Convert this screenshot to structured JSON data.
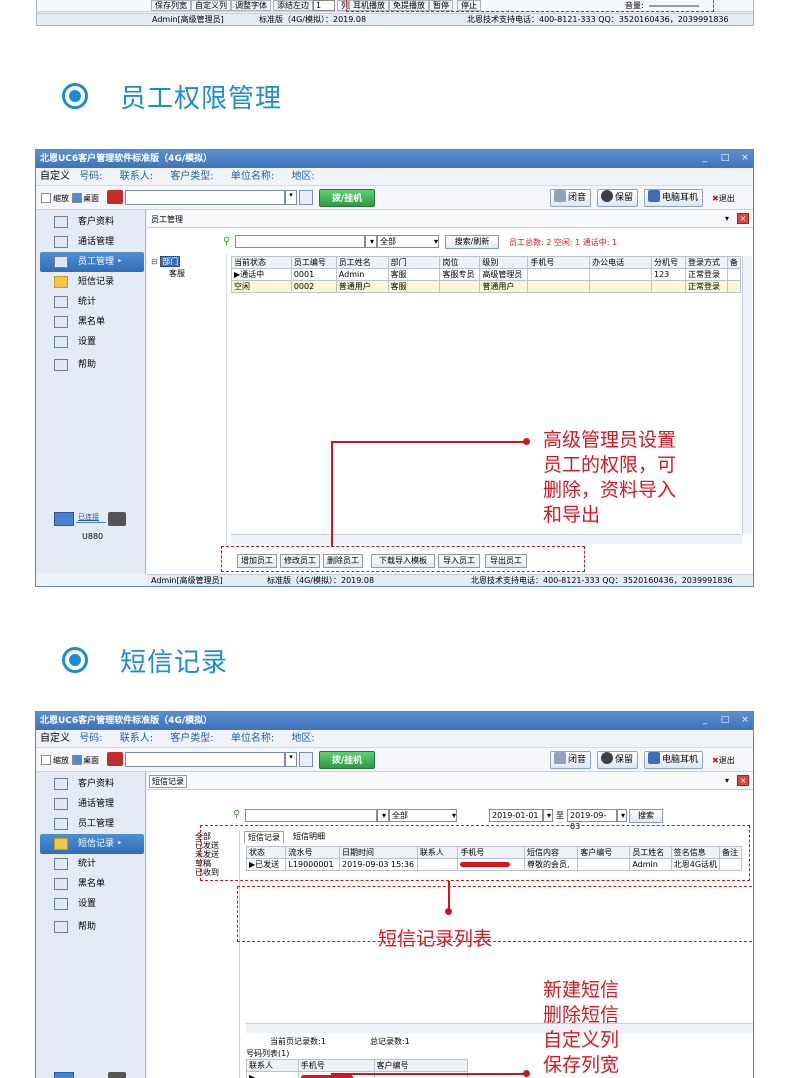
{
  "top_fragment": {
    "toolbar_items": [
      "保存列宽",
      "自定义列",
      "调整字体",
      "添结左边",
      "1",
      "列",
      "耳机播放",
      "免提播放",
      "暂停",
      "停止"
    ],
    "volume_label": "音量:",
    "status": {
      "user": "Admin[高级管理员]",
      "edition": "标准版（4G/模拟）：2019.08",
      "support": "北恩技术支持电话：400-8121-333  QQ：3520160436，2039991836"
    }
  },
  "section1": {
    "title": "员工权限管理"
  },
  "section2": {
    "title": "短信记录"
  },
  "app": {
    "title": "北恩UC6客户管理软件标准版（4G/模拟）",
    "window_controls": [
      "_",
      "□",
      "×"
    ],
    "menu": {
      "first": "自定义",
      "items": [
        "号码:",
        "联系人:",
        "客户类型:",
        "单位名称:",
        "地区:"
      ]
    },
    "toolbar": {
      "zoom": "缩放",
      "desktop": "桌面",
      "dial": "拨/挂机",
      "mute": "闭音",
      "hold": "保留",
      "pc_headset": "电脑耳机",
      "exit": "退出"
    },
    "sidebar": [
      "客户资料",
      "通话管理",
      "员工管理",
      "短信记录",
      "统计",
      "黑名单",
      "设置",
      "帮助"
    ],
    "connection": {
      "status": "已连接",
      "device": "U880"
    },
    "status": {
      "user": "Admin[高级管理员]",
      "edition": "标准版（4G/模拟）：2019.08",
      "support": "北恩技术支持电话：400-8121-333  QQ：3520160436，2039991836"
    }
  },
  "staff": {
    "tab": "员工管理",
    "filter_value": "全部",
    "search_btn": "搜索/刷新",
    "summary": "员工总数: 2  空闲: 1  通话中: 1",
    "tree": {
      "root": "部门",
      "child": "客服"
    },
    "columns": [
      "当前状态",
      "员工编号",
      "员工姓名",
      "部门",
      "岗位",
      "级别",
      "手机号",
      "办公电话",
      "分机号",
      "登录方式",
      "备"
    ],
    "rows": [
      [
        "通话中",
        "0001",
        "Admin",
        "客服",
        "客服专员",
        "高级管理员",
        "",
        "",
        "123",
        "正常登录",
        ""
      ],
      [
        "空闲",
        "0002",
        "普通用户",
        "客服",
        "",
        "普通用户",
        "",
        "",
        "",
        "正常登录",
        ""
      ]
    ],
    "buttons": [
      "增加员工",
      "修改员工",
      "删除员工",
      "下载导入模板",
      "导入员工",
      "导出员工"
    ],
    "callout": [
      "高级管理员设置",
      "员工的权限，可",
      "删除，资料导入",
      "和导出"
    ]
  },
  "sms": {
    "tab": "短信记录",
    "filter_value": "全部",
    "date_from": "2019-01-01",
    "date_to": "2019-09-03",
    "to_label": "至",
    "search_btn": "搜索",
    "tree": [
      "全部",
      "已发送",
      "未发送",
      "草稿",
      "已收到"
    ],
    "subtabs": [
      "短信记录",
      "短信明细"
    ],
    "columns": [
      "状态",
      "流水号",
      "日期时间",
      "联系人",
      "手机号",
      "短信内容",
      "客户编号",
      "员工姓名",
      "签名信息",
      "备注"
    ],
    "rows": [
      [
        "已发送",
        "L19000001",
        "2019-09-03 15:36",
        "",
        "",
        "尊敬的会员,",
        "",
        "Admin",
        "北恩4G话机",
        ""
      ]
    ],
    "page_count": "当前页记录数:1",
    "total_count": "总记录数:1",
    "numbers_title": "号码列表(1)",
    "num_columns": [
      "联系人",
      "手机号",
      "客户编号"
    ],
    "callout_list": "短信记录列表",
    "callout2": [
      "新建短信",
      "删除短信",
      "自定义列",
      "保存列宽"
    ]
  },
  "colors": {
    "accent": "#1a8cd8",
    "callout_red": "#e0141e",
    "title_blue": "#3e73bb",
    "dial_green": "#2e9a45"
  }
}
